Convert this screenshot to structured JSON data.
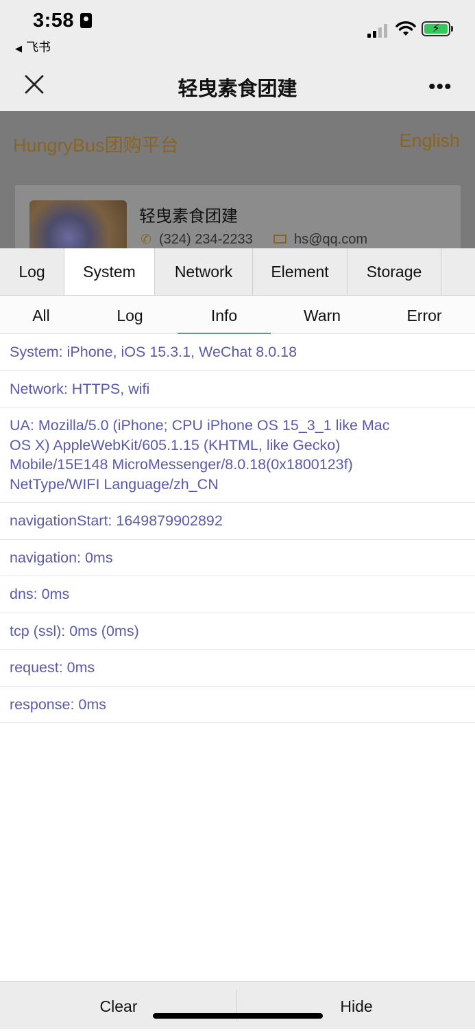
{
  "status_bar": {
    "time": "3:58",
    "back_app": "飞书",
    "battery_color": "#34c759"
  },
  "title_bar": {
    "title": "轻曳素食团建",
    "close_icon": "close-icon",
    "more_icon": "more-icon",
    "more_label": "•••"
  },
  "page_behind": {
    "brand": "HungryBus团购平台",
    "language": "English",
    "shop": {
      "name": "轻曳素食团建",
      "phone": "(324) 234-2233",
      "email": "hs@qq.com",
      "phone_icon": "phone-icon",
      "mail_icon": "mail-icon"
    }
  },
  "vconsole": {
    "tabs": [
      {
        "label": "Log"
      },
      {
        "label": "System"
      },
      {
        "label": "Network"
      },
      {
        "label": "Element"
      },
      {
        "label": "Storage"
      }
    ],
    "active_tab": "System",
    "subtabs": [
      {
        "label": "All"
      },
      {
        "label": "Log"
      },
      {
        "label": "Info"
      },
      {
        "label": "Warn"
      },
      {
        "label": "Error"
      }
    ],
    "active_subtab": "Info",
    "logs": [
      {
        "text": "System: iPhone, iOS 15.3.1, WeChat 8.0.18"
      },
      {
        "text": "Network: HTTPS, wifi"
      },
      {
        "text": "UA: Mozilla/5.0 (iPhone; CPU iPhone OS 15_3_1 like Mac OS X) AppleWebKit/605.1.15 (KHTML, like Gecko) Mobile/15E148 MicroMessenger/8.0.18(0x1800123f) NetType/WIFI Language/zh_CN"
      },
      {
        "text": "navigationStart: 1649879902892"
      },
      {
        "text": "navigation: 0ms"
      },
      {
        "text": "dns: 0ms"
      },
      {
        "text": "tcp (ssl): 0ms (0ms)"
      },
      {
        "text": "request: 0ms"
      },
      {
        "text": "response: 0ms"
      }
    ],
    "footer": {
      "clear": "Clear",
      "hide": "Hide"
    },
    "log_color": "#5a5aa8"
  }
}
